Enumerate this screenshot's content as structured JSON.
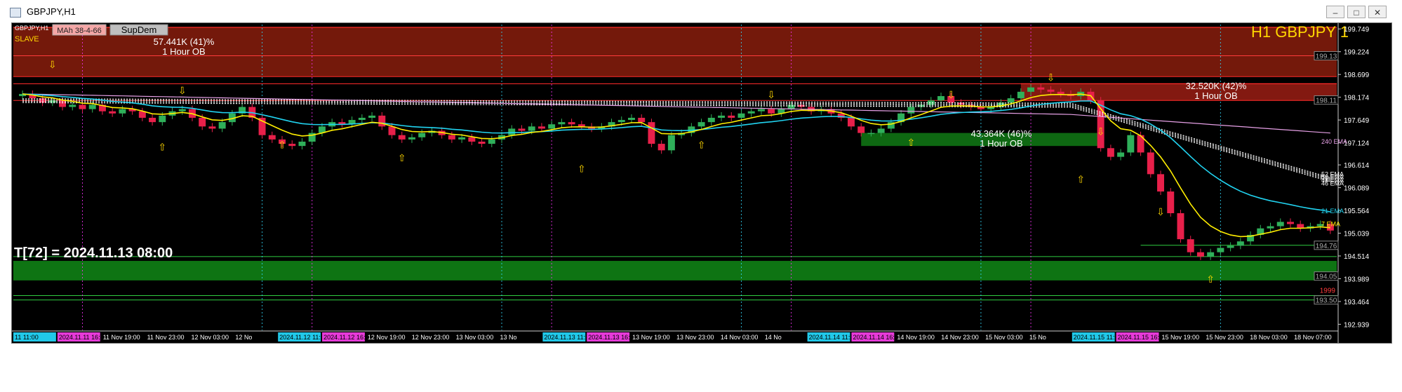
{
  "window": {
    "title": "GBPJPY,H1",
    "buttons": [
      "–",
      "□",
      "✕"
    ]
  },
  "chart_header": {
    "symbol_tag": "GBPJPY,H1",
    "mah_button": "MAh 38-4-66",
    "supdem_button": "SupDem",
    "slave_label": "SLAVE",
    "big_title": "H1 GBPJPY 1"
  },
  "time_readout": "T[72] = 2024.11.13 08:00",
  "chart_data": {
    "type": "candlestick",
    "symbol": "GBPJPY",
    "timeframe": "H1",
    "price_axis_ticks": [
      199.749,
      199.224,
      198.699,
      198.174,
      197.649,
      197.124,
      196.614,
      196.089,
      195.564,
      195.039,
      194.514,
      193.989,
      193.464,
      192.939
    ],
    "y_range": [
      192.8,
      199.85
    ],
    "time_axis_labels": [
      {
        "t": "11 11:00",
        "hl": "cyan"
      },
      {
        "t": "2024.11.11 16:00",
        "hl": "magenta"
      },
      {
        "t": "11 Nov 19:00",
        "hl": ""
      },
      {
        "t": "11 Nov 23:00",
        "hl": ""
      },
      {
        "t": "12 Nov 03:00",
        "hl": ""
      },
      {
        "t": "12 No",
        "hl": ""
      },
      {
        "t": "2024.11.12 11:00",
        "hl": "cyan"
      },
      {
        "t": "2024.11.12 16:00",
        "hl": "magenta"
      },
      {
        "t": "12 Nov 19:00",
        "hl": ""
      },
      {
        "t": "12 Nov 23:00",
        "hl": ""
      },
      {
        "t": "13 Nov 03:00",
        "hl": ""
      },
      {
        "t": "13 No",
        "hl": ""
      },
      {
        "t": "2024.11.13 11:00",
        "hl": "cyan"
      },
      {
        "t": "2024.11.13 16:00",
        "hl": "magenta"
      },
      {
        "t": "13 Nov 19:00",
        "hl": ""
      },
      {
        "t": "13 Nov 23:00",
        "hl": ""
      },
      {
        "t": "14 Nov 03:00",
        "hl": ""
      },
      {
        "t": "14 No",
        "hl": ""
      },
      {
        "t": "2024.11.14 11:00",
        "hl": "cyan"
      },
      {
        "t": "2024.11.14 16:00",
        "hl": "magenta"
      },
      {
        "t": "14 Nov 19:00",
        "hl": ""
      },
      {
        "t": "14 Nov 23:00",
        "hl": ""
      },
      {
        "t": "15 Nov 03:00",
        "hl": ""
      },
      {
        "t": "15 No",
        "hl": ""
      },
      {
        "t": "2024.11.15 11:00",
        "hl": "cyan"
      },
      {
        "t": "2024.11.15 16:00",
        "hl": "magenta"
      },
      {
        "t": "15 Nov 19:00",
        "hl": ""
      },
      {
        "t": "15 Nov 23:00",
        "hl": ""
      },
      {
        "t": "18 Nov 03:00",
        "hl": ""
      },
      {
        "t": "18 Nov 07:00",
        "hl": ""
      }
    ],
    "closes": [
      198.25,
      198.15,
      198.05,
      198.1,
      197.95,
      198.0,
      197.9,
      198.0,
      197.85,
      197.8,
      197.9,
      197.85,
      197.7,
      197.6,
      197.75,
      197.85,
      197.9,
      197.7,
      197.5,
      197.45,
      197.6,
      197.8,
      197.95,
      197.7,
      197.3,
      197.2,
      197.1,
      197.05,
      197.15,
      197.35,
      197.5,
      197.6,
      197.55,
      197.65,
      197.7,
      197.75,
      197.5,
      197.3,
      197.2,
      197.25,
      197.35,
      197.4,
      197.3,
      197.2,
      197.25,
      197.15,
      197.1,
      197.2,
      197.3,
      197.45,
      197.4,
      197.5,
      197.45,
      197.55,
      197.6,
      197.55,
      197.5,
      197.45,
      197.5,
      197.6,
      197.65,
      197.7,
      197.6,
      197.1,
      196.95,
      197.3,
      197.35,
      197.5,
      197.6,
      197.7,
      197.75,
      197.7,
      197.8,
      197.85,
      197.9,
      197.8,
      197.9,
      198.0,
      197.95,
      197.85,
      197.9,
      197.8,
      197.7,
      197.5,
      197.35,
      197.35,
      197.45,
      197.6,
      197.8,
      197.95,
      198.0,
      198.1,
      198.2,
      198.05,
      198.0,
      197.95,
      197.9,
      197.95,
      198.05,
      198.15,
      198.3,
      198.4,
      198.35,
      198.3,
      198.25,
      198.2,
      198.3,
      198.1,
      197.0,
      196.8,
      196.9,
      197.3,
      196.9,
      196.4,
      196.0,
      195.5,
      194.9,
      194.6,
      194.5,
      194.6,
      194.7,
      194.75,
      194.85,
      195.0,
      195.15,
      195.2,
      195.3,
      195.25,
      195.15,
      195.2,
      195.25,
      195.1
    ],
    "ema_labels": [
      "240 EMA",
      "52 EMA",
      "50 EMA",
      "48 EMA",
      "46 EMA",
      "21 EMA",
      "7 EMA"
    ],
    "right_price_boxes": [
      "199.13",
      "198.11",
      "194.76",
      "194.05",
      "193.50"
    ],
    "current_price": "1999",
    "zones": [
      {
        "top": 199.8,
        "bottom": 198.65,
        "label": "57.441K (41)%",
        "sub": "1 Hour OB"
      },
      {
        "top": 198.5,
        "bottom": 198.1,
        "label": "32.520K (42)%",
        "sub": "1 Hour OB"
      },
      {
        "top": 197.35,
        "bottom": 197.05,
        "label": "43.364K (46)%",
        "sub": "1 Hour OB"
      },
      {
        "top": 194.4,
        "bottom": 193.95,
        "label": "",
        "sub": ""
      }
    ]
  }
}
